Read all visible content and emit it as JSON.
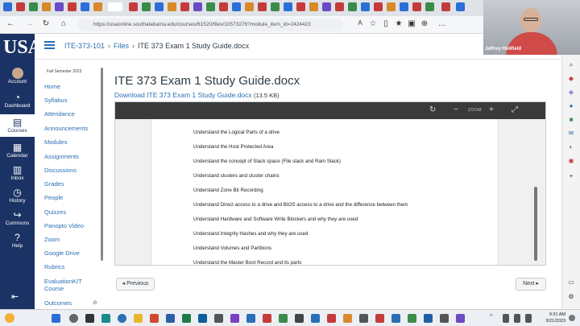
{
  "browser": {
    "url": "https://usaonline.southalabama.edu/courses/61520/files/10573276?module_item_id=2424423"
  },
  "webcam": {
    "name": "Jeffrey Holifield"
  },
  "global_nav": {
    "items": [
      {
        "label": "Account",
        "icon": "avatar-icon"
      },
      {
        "label": "Dashboard",
        "icon": "dashboard-icon"
      },
      {
        "label": "Courses",
        "icon": "book-icon"
      },
      {
        "label": "Calendar",
        "icon": "calendar-icon"
      },
      {
        "label": "Inbox",
        "icon": "inbox-icon"
      },
      {
        "label": "History",
        "icon": "clock-icon"
      },
      {
        "label": "Commons",
        "icon": "commons-icon"
      },
      {
        "label": "Help",
        "icon": "help-icon"
      }
    ]
  },
  "breadcrumb": {
    "course": "ITE-373-101",
    "section": "Files",
    "file": "ITE 373 Exam 1 Study Guide.docx"
  },
  "course_nav": {
    "term": "Fall Semester 2023",
    "items": [
      "Home",
      "Syllabus",
      "Attendance",
      "Announcements",
      "Modules",
      "Assignments",
      "Discussions",
      "Grades",
      "People",
      "Quizzes",
      "Panopto Video",
      "Zoom",
      "Google Drive",
      "Rubrics",
      "EvaluationKIT Course",
      "Outcomes"
    ]
  },
  "content": {
    "title": "ITE 373 Exam 1 Study Guide.docx",
    "download_label": "Download ITE 373 Exam 1 Study Guide.docx",
    "file_size": "(13.5 KB)",
    "zoom_label": "ZOOM",
    "lines": [
      "Understand the Logical Parts of a drive",
      "Understand the Host Protected Area",
      "Understand the concept of Slack space (File slack and Ram Slack)",
      "Understand clusters and cluster chains",
      "Understand Zone Bit Recording",
      "Understand Direct access to a drive and BIOS access to a drive and the difference between them",
      "Understand Hardware and Software Write Blockers and why they are used",
      "Understand Integrity Hashes and why they are used",
      "Understand Volumes and Partitions",
      "Understand the Master Boot Record and its parts"
    ],
    "prev_label": "◂ Previous",
    "next_label": "Next ▸"
  },
  "taskbar": {
    "time": "9:31 AM",
    "date": "9/21/2023"
  },
  "colors": {
    "nav_bg": "#1b3364",
    "link": "#2a6fb5",
    "viewer_toolbar": "#3a3a3a"
  }
}
